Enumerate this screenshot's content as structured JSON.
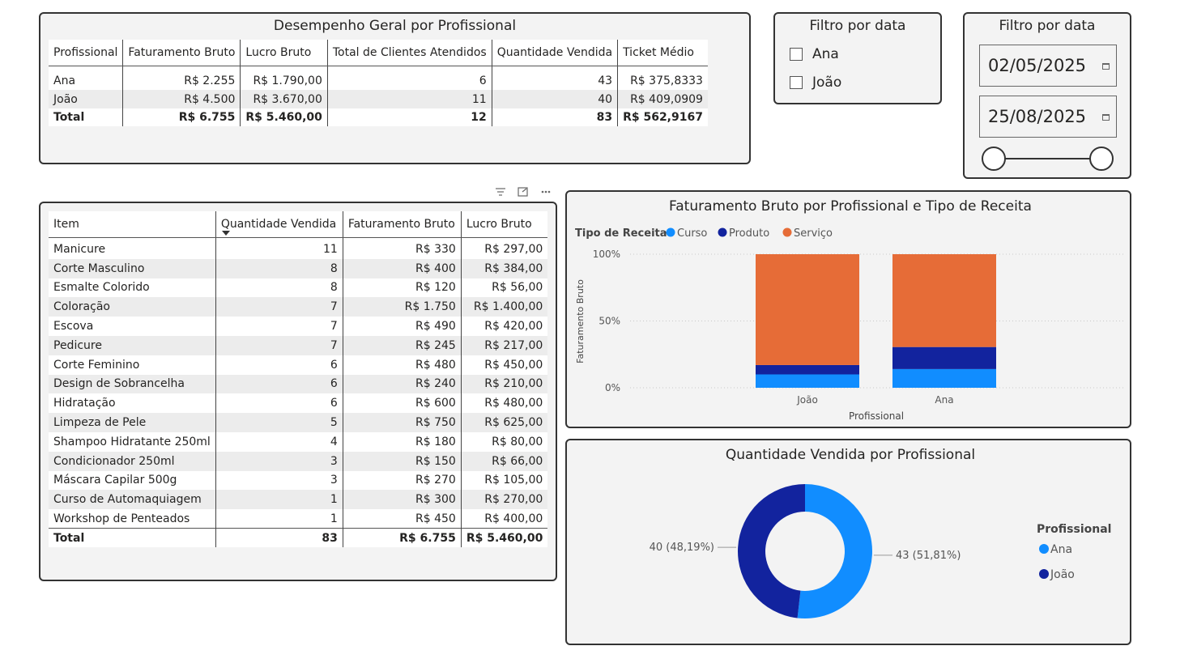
{
  "summary": {
    "title": "Desempenho Geral por Profissional",
    "headers": [
      "Profissional",
      "Faturamento Bruto",
      "Lucro Bruto",
      "Total de Clientes Atendidos",
      "Quantidade Vendida",
      "Ticket Médio"
    ],
    "rows": [
      [
        "Ana",
        "R$ 2.255",
        "R$ 1.790,00",
        "6",
        "43",
        "R$ 375,8333"
      ],
      [
        "João",
        "R$ 4.500",
        "R$ 3.670,00",
        "11",
        "40",
        "R$ 409,0909"
      ]
    ],
    "total": [
      "Total",
      "R$ 6.755",
      "R$ 5.460,00",
      "12",
      "83",
      "R$ 562,9167"
    ]
  },
  "slicer_names": {
    "title": "Filtro por data",
    "options": [
      "Ana",
      "João"
    ]
  },
  "slicer_dates": {
    "title": "Filtro por data",
    "start": "02/05/2025",
    "end": "25/08/2025"
  },
  "items_table": {
    "headers": [
      "Item",
      "Quantidade Vendida",
      "Faturamento Bruto",
      "Lucro Bruto"
    ],
    "rows": [
      [
        "Manicure",
        "11",
        "R$ 330",
        "R$ 297,00"
      ],
      [
        "Corte Masculino",
        "8",
        "R$ 400",
        "R$ 384,00"
      ],
      [
        "Esmalte Colorido",
        "8",
        "R$ 120",
        "R$ 56,00"
      ],
      [
        "Coloração",
        "7",
        "R$ 1.750",
        "R$ 1.400,00"
      ],
      [
        "Escova",
        "7",
        "R$ 490",
        "R$ 420,00"
      ],
      [
        "Pedicure",
        "7",
        "R$ 245",
        "R$ 217,00"
      ],
      [
        "Corte Feminino",
        "6",
        "R$ 480",
        "R$ 450,00"
      ],
      [
        "Design de Sobrancelha",
        "6",
        "R$ 240",
        "R$ 210,00"
      ],
      [
        "Hidratação",
        "6",
        "R$ 600",
        "R$ 480,00"
      ],
      [
        "Limpeza de Pele",
        "5",
        "R$ 750",
        "R$ 625,00"
      ],
      [
        "Shampoo Hidratante 250ml",
        "4",
        "R$ 180",
        "R$ 80,00"
      ],
      [
        "Condicionador 250ml",
        "3",
        "R$ 150",
        "R$ 66,00"
      ],
      [
        "Máscara Capilar 500g",
        "3",
        "R$ 270",
        "R$ 105,00"
      ],
      [
        "Curso de Automaquiagem",
        "1",
        "R$ 300",
        "R$ 270,00"
      ],
      [
        "Workshop de Penteados",
        "1",
        "R$ 450",
        "R$ 400,00"
      ]
    ],
    "total": [
      "Total",
      "83",
      "R$ 6.755",
      "R$ 5.460,00"
    ]
  },
  "visual_header_icons": [
    "filter-icon",
    "focus-mode-icon",
    "more-options-icon"
  ],
  "chart_data": [
    {
      "type": "bar",
      "stacked": "100%",
      "title": "Faturamento Bruto por Profissional e Tipo de Receita",
      "legend_title": "Tipo de Receita",
      "xlabel": "Profissional",
      "ylabel": "Faturamento Bruto",
      "categories": [
        "João",
        "Ana"
      ],
      "yticks": [
        "0%",
        "50%",
        "100%"
      ],
      "ylim": [
        0,
        100
      ],
      "series": [
        {
          "name": "Curso",
          "color": "#118DFF",
          "values": [
            10,
            14
          ]
        },
        {
          "name": "Produto",
          "color": "#12239E",
          "values": [
            7,
            16.5
          ]
        },
        {
          "name": "Serviço",
          "color": "#E66C37",
          "values": [
            83,
            69.5
          ]
        }
      ],
      "legend_position": "top-left",
      "grid": true
    },
    {
      "type": "pie",
      "donut": true,
      "title": "Quantidade Vendida por Profissional",
      "legend_title": "Profissional",
      "slices": [
        {
          "name": "Ana",
          "value": 43,
          "label": "43 (51,81%)",
          "color": "#118DFF"
        },
        {
          "name": "João",
          "value": 40,
          "label": "40 (48,19%)",
          "color": "#12239E"
        }
      ],
      "legend_position": "right"
    }
  ]
}
